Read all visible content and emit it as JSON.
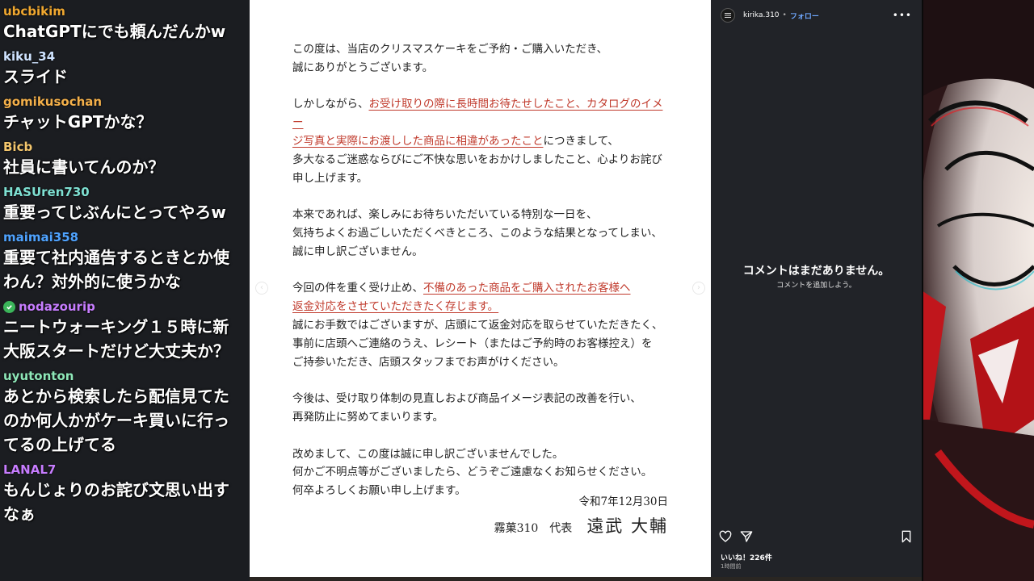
{
  "chat": {
    "messages": [
      {
        "user": "ubcbikim",
        "color": "#f0a830",
        "text": "ChatGPTにでも頼んだんかw",
        "verified": false
      },
      {
        "user": "kiku_34",
        "color": "#cfe3ff",
        "text": "スライド",
        "verified": false
      },
      {
        "user": "gomikusochan",
        "color": "#f4b04a",
        "text": "チャットGPTかな？",
        "verified": false
      },
      {
        "user": "Bicb",
        "color": "#f3c66d",
        "text": "社員に書いてんのか？",
        "verified": false
      },
      {
        "user": "HASUren730",
        "color": "#7ee0d2",
        "text": "重要ってじぶんにとってやろw",
        "verified": false
      },
      {
        "user": "maimai358",
        "color": "#4fa3ff",
        "text": "重要て社内通告するときとか使\nわん？対外的に使うかな",
        "verified": false
      },
      {
        "user": "nodazourip",
        "color": "#c77dff",
        "text": "ニートウォーキング１５時に新\n大阪スタートだけど大丈夫か？",
        "verified": true
      },
      {
        "user": "uyutonton",
        "color": "#8ee7b8",
        "text": "あとから検索したら配信見てた\nのか何人かがケーキ買いに行っ\nてるの上げてる",
        "verified": false
      },
      {
        "user": "LANAL7",
        "color": "#c77dff",
        "text": "もんじょりのお詫び文思い出す\nなぁ",
        "verified": false
      }
    ]
  },
  "letter": {
    "p1": [
      "この度は、当店のクリスマスケーキをご予約・ご購入いただき、",
      "誠にありがとうございます。"
    ],
    "p2_pre": "しかしながら、",
    "p2_red1": "お受け取りの際に長時間お待たせしたこと、カタログのイメー",
    "p2_red2": "ジ写真と実際にお渡しした商品に相違があったこと",
    "p2_post": "につきまして、",
    "p2_l3": "多大なるご迷惑ならびにご不快な思いをおかけしましたこと、心よりお詫び",
    "p2_l4": "申し上げます。",
    "p3": [
      "本来であれば、楽しみにお待ちいただいている特別な一日を、",
      "気持ちよくお過ごしいただくべきところ、このような結果となってしまい、",
      "誠に申し訳ございません。"
    ],
    "p4_pre": "今回の件を重く受け止め、",
    "p4_red1": "不備のあった商品をご購入されたお客様へ",
    "p4_red2": "返金対応をさせていただきたく存じます。",
    "p4_l3": "誠にお手数ではございますが、店頭にて返金対応を取らせていただきたく、",
    "p4_l4": "事前に店頭へご連絡のうえ、レシート（またはご予約時のお客様控え）を",
    "p4_l5": "ご持参いただき、店頭スタッフまでお声がけください。",
    "p5": [
      "今後は、受け取り体制の見直しおよび商品イメージ表記の改善を行い、",
      "再発防止に努めてまいります。"
    ],
    "p6": [
      "改めまして、この度は誠に申し訳ございませんでした。",
      "何かご不明点等がございましたら、どうぞご遠慮なくお知らせください。",
      "何卒よろしくお願い申し上げます。"
    ],
    "date": "令和7年12月30日",
    "org": "霧菓310　代表",
    "name": "遠武 大輔"
  },
  "post": {
    "username": "kirika.310",
    "separator": "•",
    "follow_label": "フォロー",
    "more_label": "•••",
    "no_comments_title": "コメントはまだありません。",
    "no_comments_sub": "コメントを追加しよう。",
    "likes": "いいね！226件",
    "time": "1時間前"
  },
  "icons": {
    "prev": "chevron-left-icon",
    "next": "chevron-right-icon",
    "like": "heart-icon",
    "share": "share-icon",
    "save": "bookmark-icon",
    "more": "more-icon",
    "verified": "verified-icon"
  },
  "colors": {
    "chat_bg": "#1b1d21",
    "side_bg": "#212328",
    "accent_red": "#c0392b",
    "follow_blue": "#6fa8ff"
  }
}
